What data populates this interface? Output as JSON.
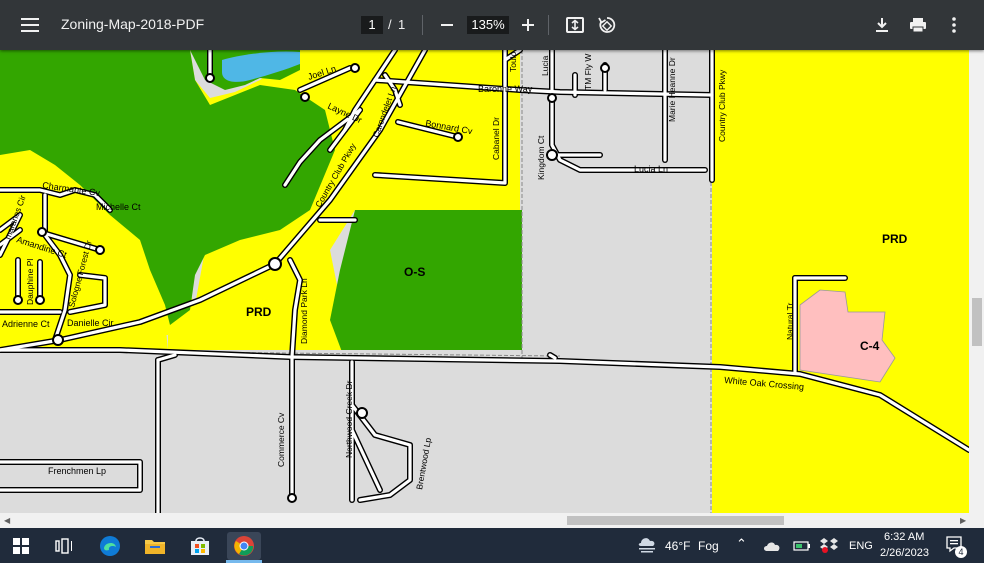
{
  "toolbar": {
    "title": "Zoning-Map-2018-PDF",
    "page_current": "1",
    "page_separator": "/",
    "page_total": "1",
    "zoom": "135%"
  },
  "map": {
    "zones": {
      "prd_west": "PRD",
      "prd_east": "PRD",
      "open_space": "O-S",
      "commercial": "C-4"
    },
    "streets": {
      "joel": "Joel Ln",
      "layne": "Layne Dr",
      "country_club_upper": "Country Club Pkwy",
      "country_club_right": "Country Club Pkwy",
      "carondelet": "Carondelet Ln",
      "bonnard": "Bonnard Cv",
      "cabanel": "Cabanel Dr",
      "baronne": "Baronne Way",
      "toulouse": "Toulo",
      "lucia_short": "Lucia",
      "tm_fly": "TM Fly W",
      "marie_heanne": "Marie Heanne Dr",
      "kingdom": "Kingdom Ct",
      "lucia_ln": "Lucia Ln",
      "charmante": "Charmante Cv",
      "michelle": "Michelle Ct",
      "amaranes": "maranes Cir",
      "amandine": "Amandine Ct",
      "sologne": "Sologne Forest Dr",
      "dauphine": "Dauphine Pl",
      "adrienne": "Adrienne Ct",
      "danielle": "Danielle Cir",
      "diamond_park": "Diamond Park Ln",
      "natural_tr": "Natural Tr",
      "white_oak": "White Oak Crossing",
      "commerce": "Commerce Cv",
      "northwood": "Northwood Creek Dr",
      "brentwood": "Brentwood Lp",
      "frenchmen": "Frenchmen Lp"
    }
  },
  "taskbar": {
    "weather_temp": "46°F",
    "weather_desc": "Fog",
    "language": "ENG",
    "time": "6:32 AM",
    "date": "2/26/2023",
    "notification_count": "4"
  },
  "colors": {
    "prd_yellow": "#ffff00",
    "open_space_green": "#33a600",
    "commercial_pink": "#ffbfbf",
    "road_gray": "#dcdcdc"
  }
}
